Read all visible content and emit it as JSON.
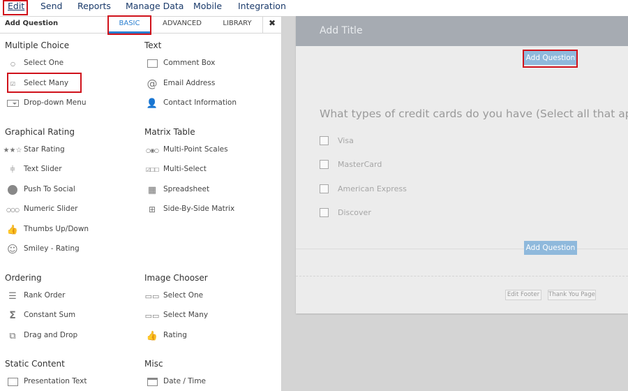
{
  "menu": [
    {
      "label": "Edit",
      "active": true
    },
    {
      "label": "Send"
    },
    {
      "label": "Reports"
    },
    {
      "label": "Manage Data"
    },
    {
      "label": "Mobile"
    },
    {
      "label": "Integration"
    }
  ],
  "panel": {
    "title": "Add Question",
    "tabs": [
      {
        "label": "BASIC",
        "active": true
      },
      {
        "label": "ADVANCED"
      },
      {
        "label": "LIBRARY"
      }
    ],
    "close_label": "✖"
  },
  "sections": {
    "multiple_choice": {
      "title": "Multiple Choice",
      "items": [
        {
          "label": "Select One",
          "icon": "radio-list-icon"
        },
        {
          "label": "Select Many",
          "icon": "checkbox-list-icon"
        },
        {
          "label": "Drop-down Menu",
          "icon": "dropdown-icon"
        }
      ]
    },
    "text": {
      "title": "Text",
      "items": [
        {
          "label": "Comment Box",
          "icon": "comment-box-icon"
        },
        {
          "label": "Email Address",
          "icon": "at-icon"
        },
        {
          "label": "Contact Information",
          "icon": "contact-icon"
        }
      ]
    },
    "graphical_rating": {
      "title": "Graphical Rating",
      "items": [
        {
          "label": "Star Rating",
          "icon": "star-icon"
        },
        {
          "label": "Text Slider",
          "icon": "slider-icon"
        },
        {
          "label": "Push To Social",
          "icon": "share-icon"
        },
        {
          "label": "Numeric Slider",
          "icon": "numeric-slider-icon"
        },
        {
          "label": "Thumbs Up/Down",
          "icon": "thumbs-up-icon"
        },
        {
          "label": "Smiley - Rating",
          "icon": "smiley-icon"
        }
      ]
    },
    "matrix_table": {
      "title": "Matrix Table",
      "items": [
        {
          "label": "Multi-Point Scales",
          "icon": "multi-point-icon"
        },
        {
          "label": "Multi-Select",
          "icon": "multi-select-icon"
        },
        {
          "label": "Spreadsheet",
          "icon": "spreadsheet-icon"
        },
        {
          "label": "Side-By-Side Matrix",
          "icon": "side-by-side-icon"
        }
      ]
    },
    "ordering": {
      "title": "Ordering",
      "items": [
        {
          "label": "Rank Order",
          "icon": "rank-order-icon"
        },
        {
          "label": "Constant Sum",
          "icon": "sigma-icon"
        },
        {
          "label": "Drag and Drop",
          "icon": "drag-drop-icon"
        }
      ]
    },
    "image_chooser": {
      "title": "Image Chooser",
      "items": [
        {
          "label": "Select One",
          "icon": "image-select-one-icon"
        },
        {
          "label": "Select Many",
          "icon": "image-select-many-icon"
        },
        {
          "label": "Rating",
          "icon": "image-rating-icon"
        }
      ]
    },
    "static_content": {
      "title": "Static Content",
      "items": [
        {
          "label": "Presentation Text",
          "icon": "presentation-text-icon"
        }
      ]
    },
    "misc": {
      "title": "Misc",
      "items": [
        {
          "label": "Date / Time",
          "icon": "calendar-icon"
        }
      ]
    }
  },
  "canvas": {
    "title_placeholder": "Add Title",
    "add_question_label": "Add Question",
    "question": "What types of credit cards do you have (Select all that apply)?",
    "options": [
      "Visa",
      "MasterCard",
      "American Express",
      "Discover"
    ],
    "footer_buttons": [
      "Edit Footer",
      "Thank You Page"
    ]
  },
  "colors": {
    "highlight": "#d0121b",
    "accent": "#2a7fd0",
    "title_bar": "#a6abb2",
    "add_question": "#8fb9dc"
  }
}
